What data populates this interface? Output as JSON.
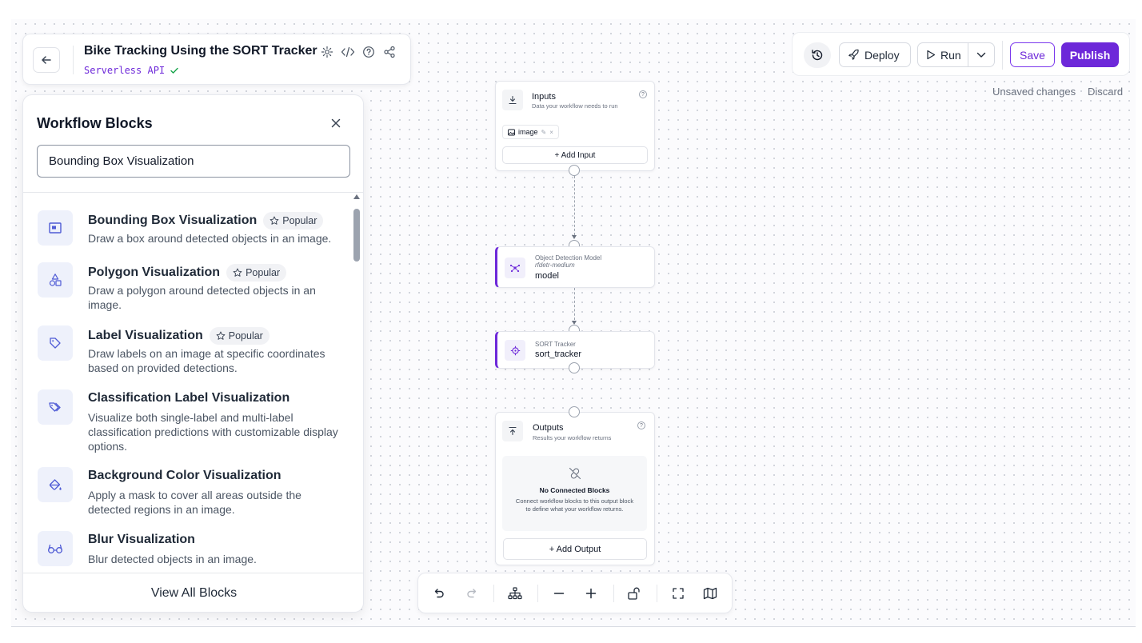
{
  "header": {
    "title": "Bike Tracking Using the SORT Tracker",
    "subtitle": "Serverless API"
  },
  "toolbar": {
    "deploy_label": "Deploy",
    "run_label": "Run",
    "save_label": "Save",
    "publish_label": "Publish",
    "unsaved_text": "Unsaved changes",
    "discard_label": "Discard"
  },
  "panel": {
    "title": "Workflow Blocks",
    "search_value": "Bounding Box Visualization",
    "view_all_label": "View All Blocks",
    "items": [
      {
        "title": "Bounding Box Visualization",
        "badge": "Popular",
        "description": "Draw a box around detected objects in an image.",
        "icon": "bounding-box-icon"
      },
      {
        "title": "Polygon Visualization",
        "badge": "Popular",
        "description": "Draw a polygon around detected objects in an image.",
        "icon": "polygon-shapes-icon"
      },
      {
        "title": "Label Visualization",
        "badge": "Popular",
        "description": "Draw labels on an image at specific coordinates based on provided detections.",
        "icon": "tag-icon"
      },
      {
        "title": "Classification Label Visualization",
        "badge": "",
        "description": "Visualize both single-label and multi-label classification predictions with customizable display options.",
        "icon": "tags-icon"
      },
      {
        "title": "Background Color Visualization",
        "badge": "",
        "description": "Apply a mask to cover all areas outside the detected regions in an image.",
        "icon": "paint-bucket-icon"
      },
      {
        "title": "Blur Visualization",
        "badge": "",
        "description": "Blur detected objects in an image.",
        "icon": "glasses-icon"
      }
    ]
  },
  "nodes": {
    "inputs": {
      "title": "Inputs",
      "subtitle": "Data your workflow needs to run",
      "chip": "image",
      "add_label": "+ Add Input"
    },
    "model": {
      "type_label": "Object Detection Model",
      "variant": "rfdetr-medium",
      "name": "model"
    },
    "tracker": {
      "type_label": "SORT Tracker",
      "name": "sort_tracker"
    },
    "outputs": {
      "title": "Outputs",
      "subtitle": "Results your workflow returns",
      "empty_title": "No Connected Blocks",
      "empty_desc": "Connect workflow blocks to this output block to define what your workflow returns.",
      "add_label": "+ Add Output"
    }
  },
  "colors": {
    "accent": "#6d28d9",
    "canvas_dots": "#cfd2da"
  }
}
